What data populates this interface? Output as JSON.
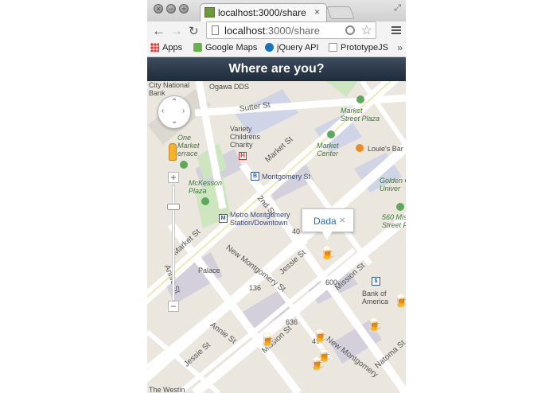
{
  "browser": {
    "tab_title": "localhost:3000/share",
    "tab_close": "×",
    "url_host": "localhost",
    "url_rest": ":3000/share",
    "back_icon": "←",
    "forward_icon": "→",
    "reload_icon": "↻",
    "star_icon": "☆",
    "bookmarks": [
      {
        "label": "Apps",
        "icon": "apps-icon"
      },
      {
        "label": "Google Maps",
        "icon": "google-maps-icon"
      },
      {
        "label": "jQuery API",
        "icon": "jquery-icon"
      },
      {
        "label": "PrototypeJS",
        "icon": "page-icon"
      }
    ],
    "bookmarks_more": "»"
  },
  "header": {
    "title": "Where are you?"
  },
  "map": {
    "labels": {
      "city_national_bank": "City National\nBank",
      "ogawa_dds": "Ogawa DDS",
      "sutter_st": "Sutter St",
      "market_street_plaza": "Market\nStreet Plaza",
      "variety_childrens_charity": "Variety\nChildrens\nCharity",
      "market_st_1": "Market St",
      "one_market_terrace": "One\nMarket\nerrace",
      "market_center": "Market\nCenter",
      "louies_bar": "Louie's Bar",
      "montgomery_st": "Montgomery St",
      "golden_gate_univ": "Golden G\nUniver",
      "mckesson_plaza": "McKesson\nPlaza",
      "second_st": "2nd St",
      "metro_montgomery": "Metro Montgomery\nStation/Downtown",
      "new_montgomery_st_1": "New Montgomery St",
      "market_st_2": "Market St",
      "mission_street_1": "560 Missi\nStreet P",
      "palace": "Palace",
      "jessie_st_1": "Jessie St",
      "mission_st_1": "Mission St",
      "annie_st_1": "Annie St",
      "bank_of_america": "Bank of\nAmerica",
      "annie_st_2": "Annie St",
      "jessie_st_2": "Jessie St",
      "mission_st_2": "Mission St",
      "new_montgomery_st_2": "New Montgomery",
      "natoma_st": "Natoma St",
      "the_westin": "The Westin",
      "num_40": "40",
      "num_600": "600",
      "num_136": "136",
      "num_636": "636",
      "num_40b": "40"
    },
    "info_window": {
      "text": "Dada",
      "close": "×"
    },
    "controls": {
      "zoom_in": "+",
      "zoom_out": "−"
    }
  }
}
